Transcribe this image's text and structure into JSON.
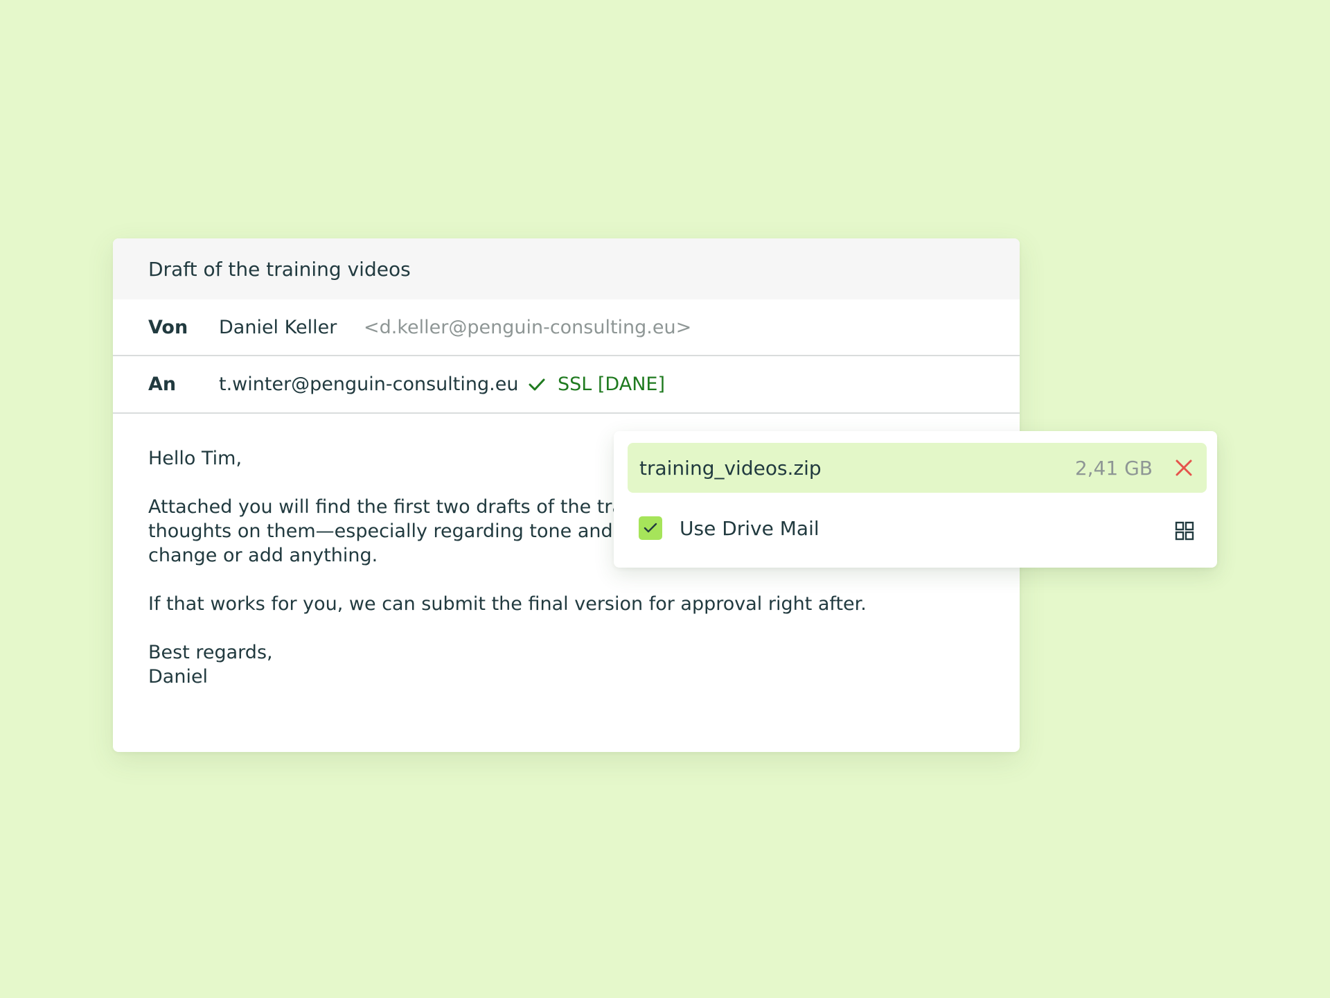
{
  "colors": {
    "background": "#e5f8cb",
    "subject_bar": "#f6f6f6",
    "card": "#ffffff",
    "text_primary": "#213a3f",
    "text_muted": "#8e9695",
    "ssl_green": "#1f7a1f",
    "attachment_highlight": "#e3f7c8",
    "checkbox_green": "#a6e45a",
    "remove_red": "#e5534b"
  },
  "email": {
    "subject": "Draft of the training videos",
    "from": {
      "label": "Von",
      "name": "Daniel Keller",
      "address": "<d.keller@penguin-consulting.eu>"
    },
    "to": {
      "label": "An",
      "address": "t.winter@penguin-consulting.eu",
      "security": "SSL [DANE]",
      "security_icon": "check-icon"
    },
    "body": {
      "greeting": "Hello Tim,",
      "para1_line1": "Attached you will find the first two drafts of the trainir",
      "para1_line2": "thoughts on them—especially regarding tone and pac",
      "para1_line3": "change or add anything.",
      "para2": "If that works for you, we can submit the final version for approval right after.",
      "closing": "Best regards,",
      "signature": "Daniel"
    }
  },
  "attachment": {
    "file_name": "training_videos.zip",
    "file_size": "2,41 GB",
    "remove_icon": "close-icon",
    "drive_mail_label": "Use Drive Mail",
    "drive_mail_checked": true,
    "grid_icon": "grid-icon"
  }
}
